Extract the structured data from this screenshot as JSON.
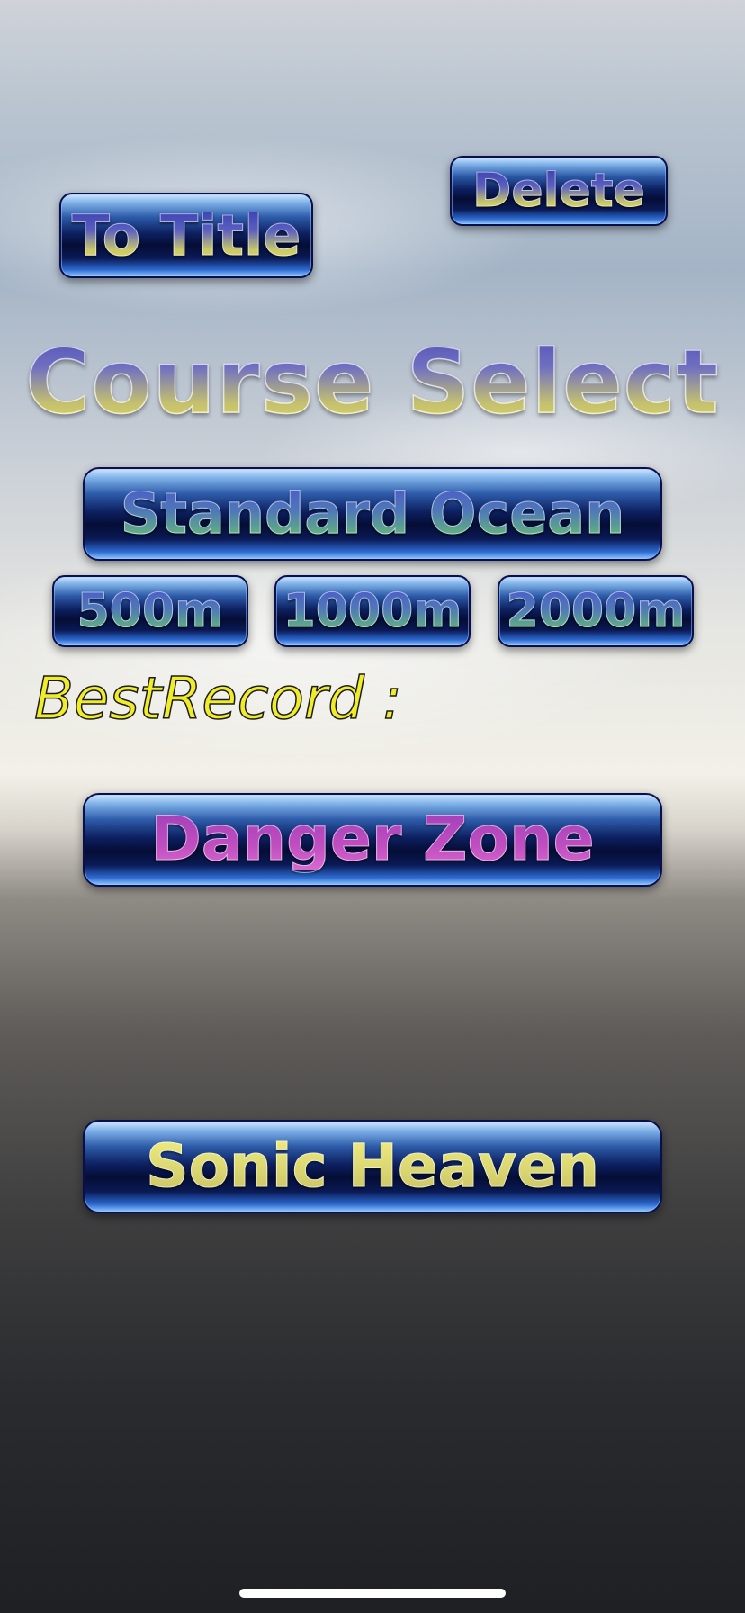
{
  "top_bar": {
    "to_title_label": "To Title",
    "delete_label": "Delete"
  },
  "screen": {
    "title": "Course Select"
  },
  "courses": {
    "standard_ocean": {
      "label": "Standard Ocean",
      "distances": [
        "500m",
        "1000m",
        "2000m"
      ]
    },
    "best_record_label": "BestRecord :",
    "danger_zone": {
      "label": "Danger Zone"
    },
    "sonic_heaven": {
      "label": "Sonic Heaven"
    }
  },
  "colors": {
    "button_dark_blue": "#050d35",
    "button_highlight": "#8fc7ff",
    "best_record_yellow": "#f0ec2a",
    "danger_zone_text": "#c04ec0",
    "sonic_heaven_text": "#d8d470"
  }
}
